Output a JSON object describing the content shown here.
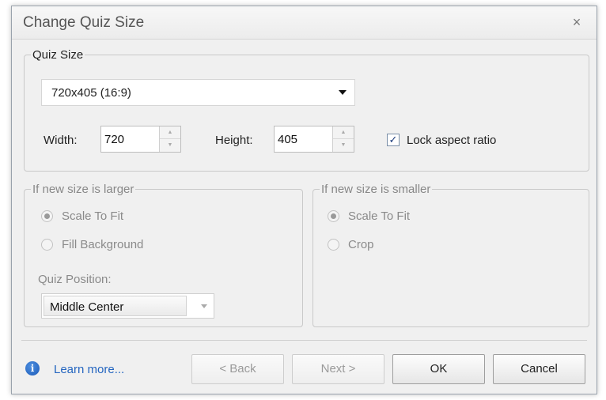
{
  "dialog": {
    "title": "Change Quiz Size",
    "close_label": "×"
  },
  "quiz_size": {
    "legend": "Quiz Size",
    "preset_value": "720x405 (16:9)",
    "width_label": "Width:",
    "width_value": "720",
    "height_label": "Height:",
    "height_value": "405",
    "lock_label": "Lock aspect ratio",
    "lock_checked": true
  },
  "if_larger": {
    "legend": "If new size is larger",
    "options": [
      {
        "label": "Scale To Fit",
        "selected": true
      },
      {
        "label": "Fill Background",
        "selected": false
      }
    ],
    "position_label": "Quiz Position:",
    "position_value": "Middle Center"
  },
  "if_smaller": {
    "legend": "If new size is smaller",
    "options": [
      {
        "label": "Scale To Fit",
        "selected": true
      },
      {
        "label": "Crop",
        "selected": false
      }
    ]
  },
  "footer": {
    "learn_more": "Learn more...",
    "back_label": "< Back",
    "next_label": "Next >",
    "ok_label": "OK",
    "cancel_label": "Cancel"
  }
}
